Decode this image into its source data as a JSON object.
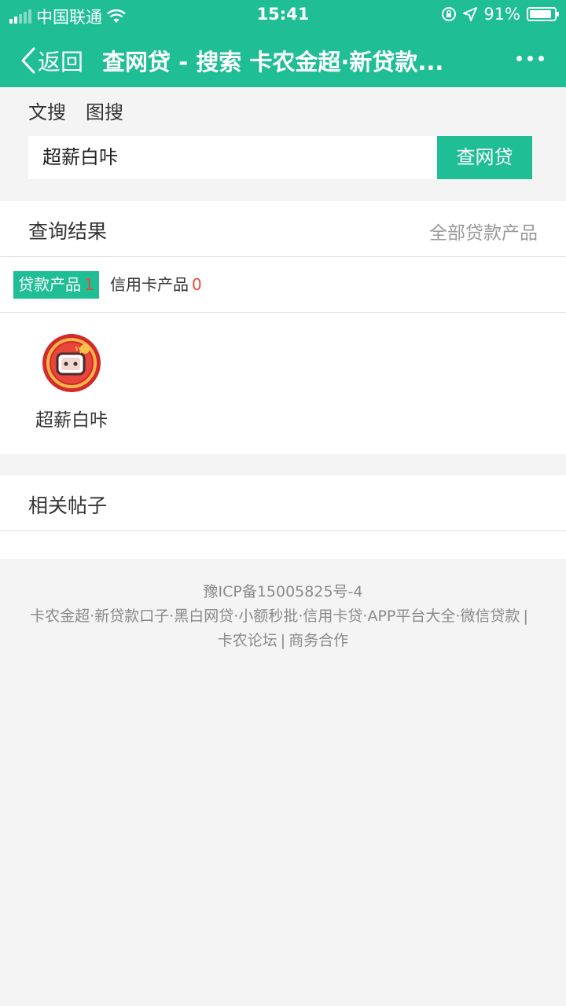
{
  "status_bar": {
    "carrier": "中国联通",
    "time": "15:41",
    "battery": "91%",
    "battery_level": 0.91
  },
  "nav": {
    "back_label": "返回",
    "title": "查网贷 - 搜索 卡农金超·新贷款..."
  },
  "search": {
    "tabs": [
      "文搜",
      "图搜"
    ],
    "query": "超薪白咔",
    "button_label": "查网贷"
  },
  "results": {
    "title": "查询结果",
    "all_link": "全部贷款产品",
    "filters": [
      {
        "label": "贷款产品",
        "count": "1"
      },
      {
        "label": "信用卡产品",
        "count": "0"
      }
    ],
    "products": [
      {
        "name": "超薪白咔"
      }
    ]
  },
  "related": {
    "title": "相关帖子"
  },
  "footer": {
    "icp": "豫ICP备15005825号-4",
    "links": [
      "卡农金超",
      "新贷款口子",
      "黑白网贷",
      "小额秒批",
      "信用卡贷",
      "APP平台大全",
      "微信贷款"
    ],
    "bottom_links": [
      "卡农论坛",
      "商务合作"
    ]
  },
  "colors": {
    "brand": "#1fbe95",
    "count_red": "#e54b3c"
  }
}
